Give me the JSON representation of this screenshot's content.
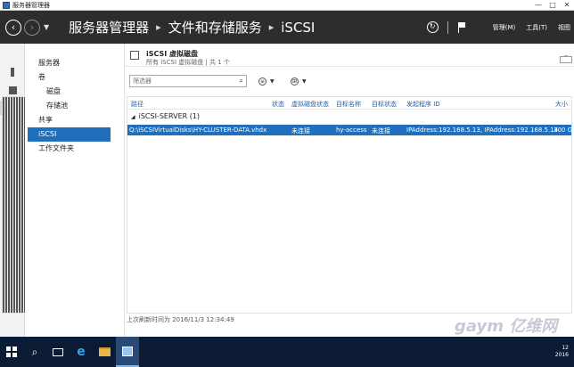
{
  "window": {
    "title": "服务器管理器",
    "buttons": {
      "minimize": "—",
      "maximize": "□",
      "close": "✕"
    }
  },
  "header": {
    "breadcrumb": [
      "服务器管理器",
      "文件和存储服务",
      "iSCSI"
    ],
    "menus": [
      "管理(M)",
      "工具(T)",
      "视图"
    ],
    "icons": {
      "back": "back-icon",
      "forward": "forward-icon",
      "refresh": "refresh-icon",
      "flag": "flag-icon"
    }
  },
  "iconstrip": [
    "dashboard-icon",
    "local-server-icon",
    "all-servers-icon",
    "file-storage-icon"
  ],
  "nav": {
    "items": [
      {
        "label": "服务器",
        "level": 0
      },
      {
        "label": "卷",
        "level": 0
      },
      {
        "label": "磁盘",
        "level": 1
      },
      {
        "label": "存储池",
        "level": 1
      },
      {
        "label": "共享",
        "level": 0
      },
      {
        "label": "iSCSI",
        "level": 0,
        "selected": true
      },
      {
        "label": "工作文件夹",
        "level": 0
      }
    ]
  },
  "tile": {
    "title": "iSCSI 虚拟磁盘",
    "subtitle": "所有 iSCSI 虚拟磁盘 | 共 1 个",
    "filter_placeholder": "筛选器"
  },
  "grid": {
    "columns": [
      "路径",
      "状态",
      "虚拟磁盘状态",
      "目标名称",
      "目标状态",
      "发起程序 ID",
      "大小"
    ],
    "group": "iSCSI-SERVER (1)",
    "rows": [
      {
        "path": "Q:\\iSCSIVirtualDisks\\HY-CLUSTER-DATA.vhdx",
        "status": "",
        "disk_status": "未连接",
        "target_name": "hy-access",
        "target_status": "未连接",
        "initiator_id": "IPAddress:192.168.5.13, IPAddress:192.168.5.14",
        "size": "300 G"
      }
    ]
  },
  "status_bar": "上次刷新时间为 2016/11/3 12:34:49",
  "taskbar": {
    "tray_time": "12",
    "tray_date": "2016"
  },
  "watermark": "gaym 亿维网"
}
